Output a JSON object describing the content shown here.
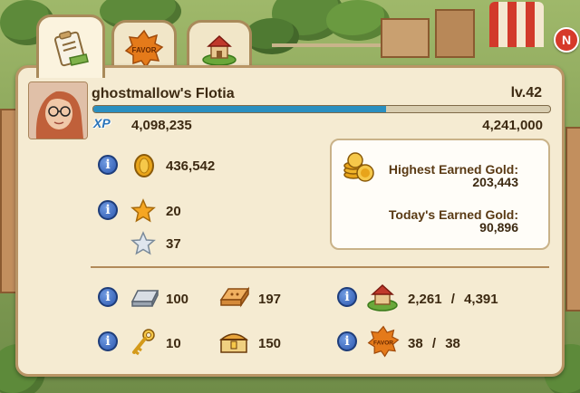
{
  "profile": {
    "farm_name": "ghostmallow's Flotia",
    "level": "lv.42",
    "xp_label": "XP",
    "xp_current": "4,098,235",
    "xp_max": "4,241,000",
    "xp_progress": 0.64
  },
  "resources": {
    "coins": "436,542",
    "gold_stars": "20",
    "silver_stars": "37",
    "iron": "100",
    "bricks": "197",
    "keys": "10",
    "chests": "150",
    "farm_count": "2,261",
    "farm_total": "4,391",
    "favor_count": "38",
    "favor_total": "38",
    "separator": "/"
  },
  "gold_box": {
    "highest_label": "Highest Earned Gold:",
    "highest_value": "203,443",
    "today_label": "Today's Earned Gold:",
    "today_value": "90,896"
  },
  "info_glyph": "i",
  "close_glyph": "N",
  "tabs": [
    {
      "name": "profile",
      "icon": "clipboard-icon"
    },
    {
      "name": "favor",
      "icon": "favor-badge-icon"
    },
    {
      "name": "neighbors",
      "icon": "farm-house-icon"
    }
  ],
  "favor_badge_text": "FAVOR",
  "colors": {
    "panel_bg": "#f5ebd2",
    "panel_border": "#b99566",
    "xp_fill": "#2a8fc0",
    "info_blue": "#2d58b0",
    "text_dark": "#3d2a12"
  }
}
